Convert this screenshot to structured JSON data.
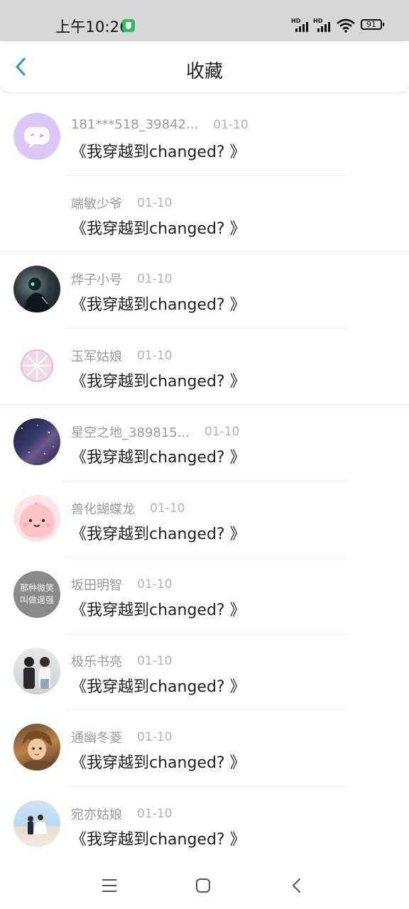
{
  "status_bar": {
    "time": "上午10:26",
    "network_label_1": "HD",
    "network_label_2": "HD",
    "battery": "91"
  },
  "header": {
    "title": "收藏",
    "back_icon": "chevron-left-icon"
  },
  "items": [
    {
      "name": "181***518_39842...",
      "date": "01-10",
      "message": "《我穿越到changed? 》",
      "avatar": "chat-bubble-avatar"
    },
    {
      "name": "端敏少爷",
      "date": "01-10",
      "message": "《我穿越到changed? 》",
      "avatar": "none"
    },
    {
      "name": "烨子小号",
      "date": "01-10",
      "message": "《我穿越到changed? 》",
      "avatar": "dark-figure-avatar"
    },
    {
      "name": "玉军姑娘",
      "date": "01-10",
      "message": "《我穿越到changed? 》",
      "avatar": "citrus-slice-avatar"
    },
    {
      "name": "星空之地_389815...",
      "date": "01-10",
      "message": "《我穿越到changed? 》",
      "avatar": "starry-sky-avatar"
    },
    {
      "name": "兽化蝴蝶龙",
      "date": "01-10",
      "message": "《我穿越到changed? 》",
      "avatar": "pink-creature-avatar"
    },
    {
      "name": "坂田明智",
      "date": "01-10",
      "message": "《我穿越到changed? 》",
      "avatar": "text-avatar"
    },
    {
      "name": "极乐书亮",
      "date": "01-10",
      "message": "《我穿越到changed? 》",
      "avatar": "couple-photo-avatar"
    },
    {
      "name": "通幽冬菱",
      "date": "01-10",
      "message": "《我穿越到changed? 》",
      "avatar": "anime-boy-avatar"
    },
    {
      "name": "宛亦姑娘",
      "date": "01-10",
      "message": "《我穿越到changed? 》",
      "avatar": "beach-photo-avatar"
    }
  ],
  "text_avatar": {
    "line1": "那种微笑",
    "line2": "叫做逞强"
  },
  "nav": {
    "menu_icon": "menu-icon",
    "home_icon": "home-icon",
    "back_icon": "back-icon"
  },
  "colors": {
    "accent": "#2a8fd8",
    "status_bar_bg": "#d7d7d7"
  }
}
